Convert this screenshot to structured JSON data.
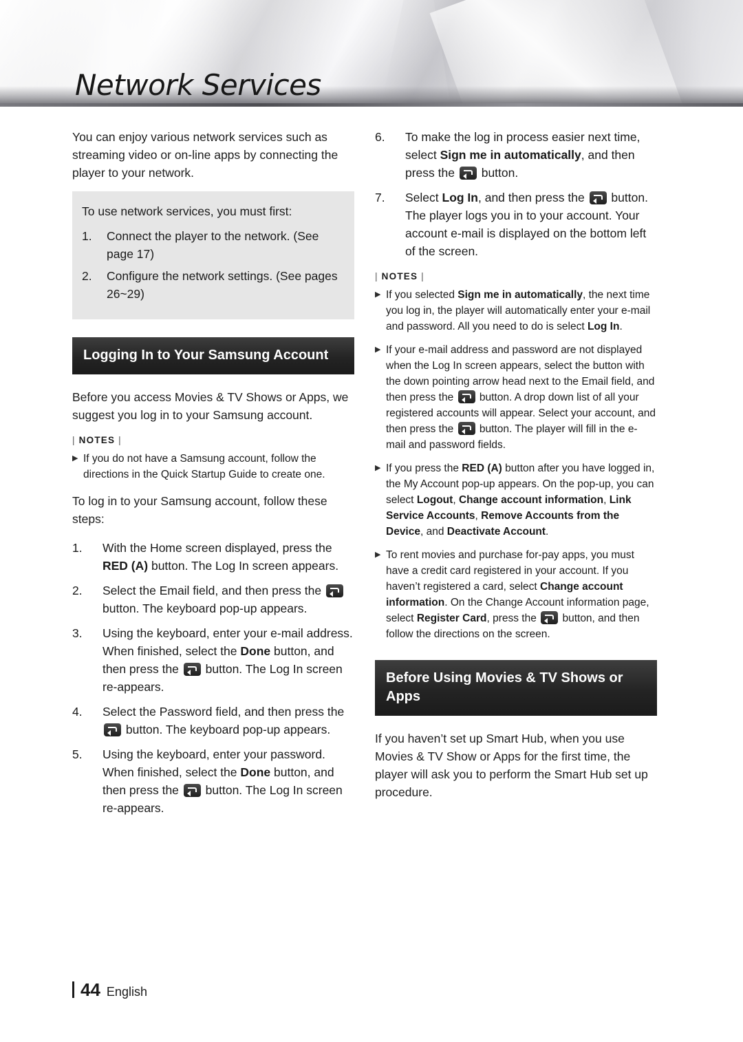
{
  "header": {
    "title": "Network Services"
  },
  "left": {
    "intro": "You can enjoy various network services such as streaming video or on-line apps by connecting the player to your network.",
    "infobox": {
      "lead": "To use network services, you must first:",
      "items": [
        {
          "num": "1.",
          "text": "Connect the player to the network. (See page 17)"
        },
        {
          "num": "2.",
          "text": "Configure the network settings. (See pages 26~29)"
        }
      ]
    },
    "section_heading": "Logging In to Your Samsung Account",
    "para1": "Before you access Movies & TV Shows or Apps, we suggest you log in to your Samsung account.",
    "notes_label": "NOTES",
    "notes": [
      "If you do not have a Samsung account, follow the directions in the Quick Startup Guide to create one."
    ],
    "para2": "To log in to your Samsung account, follow these steps:",
    "steps": [
      {
        "num": "1.",
        "parts": [
          {
            "t": "With the Home screen displayed, press the "
          },
          {
            "t": "RED (A)",
            "b": true
          },
          {
            "t": " button. The Log In screen appears."
          }
        ]
      },
      {
        "num": "2.",
        "parts": [
          {
            "t": "Select the Email field, and then press the "
          },
          {
            "icon": "enter-button-icon"
          },
          {
            "t": " button. The keyboard pop-up appears."
          }
        ]
      },
      {
        "num": "3.",
        "parts": [
          {
            "t": "Using the keyboard, enter your e-mail address. When finished, select the "
          },
          {
            "t": "Done",
            "b": true
          },
          {
            "t": " button, and then press the "
          },
          {
            "icon": "enter-button-icon"
          },
          {
            "t": " button. The Log In screen re-appears."
          }
        ]
      },
      {
        "num": "4.",
        "parts": [
          {
            "t": "Select the Password field, and then press the "
          },
          {
            "icon": "enter-button-icon"
          },
          {
            "t": " button. The keyboard pop-up appears."
          }
        ]
      },
      {
        "num": "5.",
        "parts": [
          {
            "t": "Using the keyboard, enter your password. When finished, select the "
          },
          {
            "t": "Done",
            "b": true
          },
          {
            "t": " button, and then press the "
          },
          {
            "icon": "enter-button-icon"
          },
          {
            "t": " button. The Log In screen re-appears."
          }
        ]
      }
    ]
  },
  "right": {
    "steps": [
      {
        "num": "6.",
        "parts": [
          {
            "t": "To make the log in process easier next time, select "
          },
          {
            "t": "Sign me in automatically",
            "b": true
          },
          {
            "t": ", and then press the "
          },
          {
            "icon": "enter-button-icon"
          },
          {
            "t": " button."
          }
        ]
      },
      {
        "num": "7.",
        "parts": [
          {
            "t": "Select "
          },
          {
            "t": "Log In",
            "b": true
          },
          {
            "t": ", and then press the "
          },
          {
            "icon": "enter-button-icon"
          },
          {
            "t": " button. The player logs you in to your account. Your account e-mail is displayed on the bottom left of the screen."
          }
        ]
      }
    ],
    "notes_label": "NOTES",
    "notes": [
      {
        "parts": [
          {
            "t": "If you selected "
          },
          {
            "t": "Sign me in automatically",
            "b": true
          },
          {
            "t": ", the next time you log in, the player will automatically enter your e-mail and password. All you need to do is select "
          },
          {
            "t": "Log In",
            "b": true
          },
          {
            "t": "."
          }
        ]
      },
      {
        "parts": [
          {
            "t": "If your e-mail address and password are not displayed when the Log In screen appears, select the button with the down pointing arrow head next to the Email field, and then press the "
          },
          {
            "icon": "enter-button-icon"
          },
          {
            "t": " button. A drop down list of all your registered accounts will appear. Select your account, and then press the "
          },
          {
            "icon": "enter-button-icon"
          },
          {
            "t": " button. The player will fill in the e-mail and password fields."
          }
        ]
      },
      {
        "parts": [
          {
            "t": "If you press the "
          },
          {
            "t": "RED (A)",
            "b": true
          },
          {
            "t": " button after you have logged in, the My Account pop-up appears. On the pop-up, you can select "
          },
          {
            "t": "Logout",
            "b": true
          },
          {
            "t": ", "
          },
          {
            "t": "Change account information",
            "b": true
          },
          {
            "t": ", "
          },
          {
            "t": "Link Service Accounts",
            "b": true
          },
          {
            "t": ", "
          },
          {
            "t": "Remove Accounts from the Device",
            "b": true
          },
          {
            "t": ", and "
          },
          {
            "t": "Deactivate Account",
            "b": true
          },
          {
            "t": "."
          }
        ]
      },
      {
        "parts": [
          {
            "t": "To rent movies and purchase for-pay apps, you must have a credit card registered in your account. If you haven’t registered a card, select "
          },
          {
            "t": "Change account information",
            "b": true
          },
          {
            "t": ". On the Change Account information page, select "
          },
          {
            "t": "Register Card",
            "b": true
          },
          {
            "t": ", press the "
          },
          {
            "icon": "enter-button-icon"
          },
          {
            "t": " button, and then follow the directions on the screen."
          }
        ]
      }
    ],
    "section_heading": "Before Using Movies & TV Shows or Apps",
    "para1": "If you haven’t set up Smart Hub, when you use Movies & TV Show or Apps for the first time, the player will ask you to perform the Smart Hub set up procedure."
  },
  "footer": {
    "page_number": "44",
    "language": "English"
  }
}
